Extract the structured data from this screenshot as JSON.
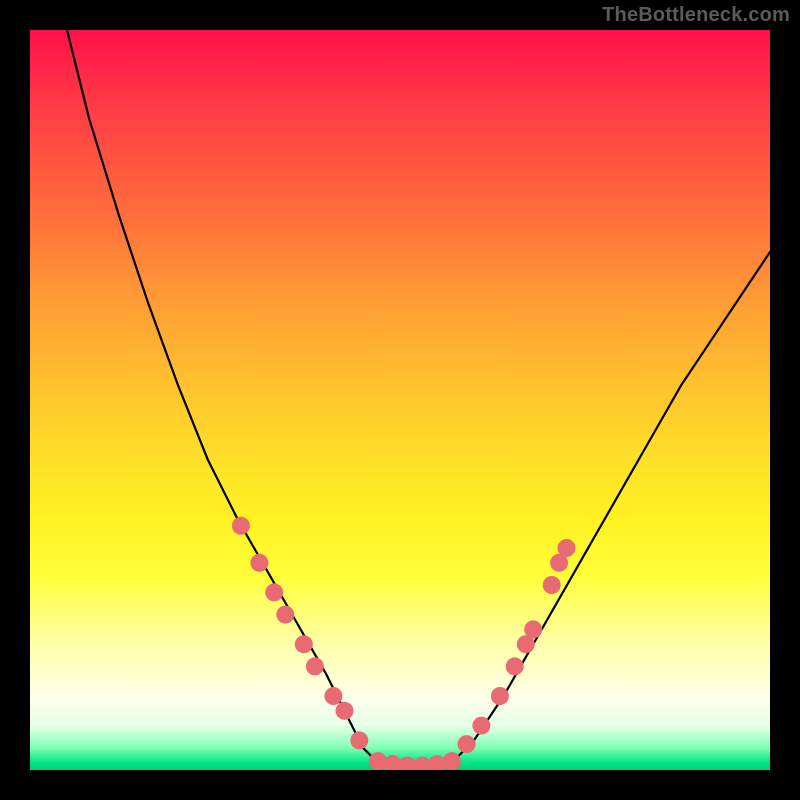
{
  "watermark": "TheBottleneck.com",
  "colors": {
    "frame": "#000000",
    "curve": "#000000",
    "dot": "#e86b74",
    "gradient_stops": [
      {
        "pct": 0,
        "hex": "#ff104a"
      },
      {
        "pct": 10,
        "hex": "#ff3a46"
      },
      {
        "pct": 24,
        "hex": "#ff6a3c"
      },
      {
        "pct": 36,
        "hex": "#ff9a36"
      },
      {
        "pct": 48,
        "hex": "#ffc22e"
      },
      {
        "pct": 58,
        "hex": "#ffe028"
      },
      {
        "pct": 66,
        "hex": "#fff122"
      },
      {
        "pct": 74,
        "hex": "#ffff3a"
      },
      {
        "pct": 82,
        "hex": "#ffffa0"
      },
      {
        "pct": 90,
        "hex": "#ffffe8"
      },
      {
        "pct": 94,
        "hex": "#e6ffe8"
      },
      {
        "pct": 97,
        "hex": "#80ffb4"
      },
      {
        "pct": 99,
        "hex": "#00e684"
      },
      {
        "pct": 100,
        "hex": "#00d074"
      }
    ]
  },
  "chart_data": {
    "type": "line",
    "title": "",
    "xlabel": "",
    "ylabel": "",
    "xlim": [
      0,
      100
    ],
    "ylim": [
      0,
      100
    ],
    "series": [
      {
        "name": "bottleneck-curve-left",
        "x": [
          5,
          8,
          12,
          16,
          20,
          24,
          28,
          32,
          36,
          40,
          43,
          45,
          47
        ],
        "y": [
          100,
          88,
          75,
          63,
          52,
          42,
          34,
          27,
          20,
          13,
          7,
          3,
          1
        ]
      },
      {
        "name": "bottleneck-curve-flat",
        "x": [
          47,
          49,
          51,
          53,
          55,
          57
        ],
        "y": [
          1,
          0.6,
          0.5,
          0.5,
          0.6,
          1
        ]
      },
      {
        "name": "bottleneck-curve-right",
        "x": [
          57,
          60,
          64,
          68,
          72,
          76,
          80,
          84,
          88,
          92,
          96,
          100
        ],
        "y": [
          1,
          4,
          10,
          17,
          24,
          31,
          38,
          45,
          52,
          58,
          64,
          70
        ]
      }
    ],
    "points": [
      {
        "name": "left-dot-1",
        "x": 28.5,
        "y": 33
      },
      {
        "name": "left-dot-2",
        "x": 31.0,
        "y": 28
      },
      {
        "name": "left-dot-3",
        "x": 33.0,
        "y": 24
      },
      {
        "name": "left-dot-4",
        "x": 34.5,
        "y": 21
      },
      {
        "name": "left-dot-5",
        "x": 37.0,
        "y": 17
      },
      {
        "name": "left-dot-6",
        "x": 38.5,
        "y": 14
      },
      {
        "name": "left-dot-7",
        "x": 41.0,
        "y": 10
      },
      {
        "name": "left-dot-8",
        "x": 42.5,
        "y": 8
      },
      {
        "name": "left-dot-9",
        "x": 44.5,
        "y": 4
      },
      {
        "name": "flat-dot-1",
        "x": 47.0,
        "y": 1.2
      },
      {
        "name": "flat-dot-2",
        "x": 49.0,
        "y": 0.8
      },
      {
        "name": "flat-dot-3",
        "x": 51.0,
        "y": 0.6
      },
      {
        "name": "flat-dot-4",
        "x": 53.0,
        "y": 0.6
      },
      {
        "name": "flat-dot-5",
        "x": 55.0,
        "y": 0.8
      },
      {
        "name": "flat-dot-6",
        "x": 57.0,
        "y": 1.2
      },
      {
        "name": "right-dot-1",
        "x": 59.0,
        "y": 3.5
      },
      {
        "name": "right-dot-2",
        "x": 61.0,
        "y": 6
      },
      {
        "name": "right-dot-3",
        "x": 63.5,
        "y": 10
      },
      {
        "name": "right-dot-4",
        "x": 65.5,
        "y": 14
      },
      {
        "name": "right-dot-5",
        "x": 67.0,
        "y": 17
      },
      {
        "name": "right-dot-6",
        "x": 68.0,
        "y": 19
      },
      {
        "name": "right-dot-7",
        "x": 70.5,
        "y": 25
      },
      {
        "name": "right-dot-8",
        "x": 71.5,
        "y": 28
      },
      {
        "name": "right-dot-9",
        "x": 72.5,
        "y": 30
      }
    ]
  }
}
